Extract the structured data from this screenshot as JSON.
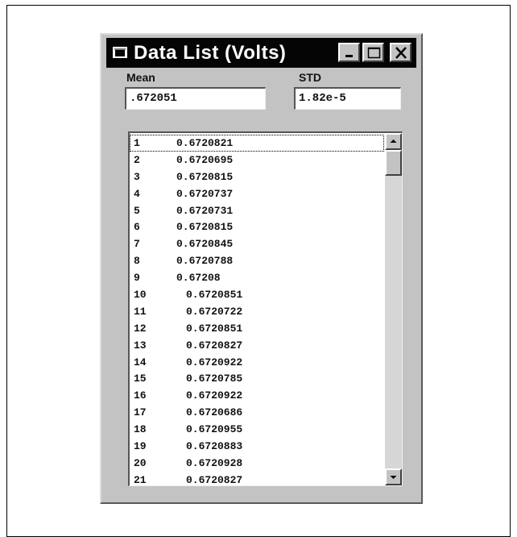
{
  "window": {
    "title": "Data List (Volts)"
  },
  "fields": {
    "mean_label": "Mean",
    "mean_value": ".672051",
    "std_label": "STD",
    "std_value": "1.82e-5"
  },
  "list": {
    "rows": [
      {
        "num": "1",
        "value": "0.6720821"
      },
      {
        "num": "2",
        "value": "0.6720695"
      },
      {
        "num": "3",
        "value": "0.6720815"
      },
      {
        "num": "4",
        "value": "0.6720737"
      },
      {
        "num": "5",
        "value": "0.6720731"
      },
      {
        "num": "6",
        "value": "0.6720815"
      },
      {
        "num": "7",
        "value": "0.6720845"
      },
      {
        "num": "8",
        "value": "0.6720788"
      },
      {
        "num": "9",
        "value": "0.67208"
      },
      {
        "num": "10",
        "value": "0.6720851"
      },
      {
        "num": "11",
        "value": "0.6720722"
      },
      {
        "num": "12",
        "value": "0.6720851"
      },
      {
        "num": "13",
        "value": "0.6720827"
      },
      {
        "num": "14",
        "value": "0.6720922"
      },
      {
        "num": "15",
        "value": "0.6720785"
      },
      {
        "num": "16",
        "value": "0.6720922"
      },
      {
        "num": "17",
        "value": "0.6720686"
      },
      {
        "num": "18",
        "value": "0.6720955"
      },
      {
        "num": "19",
        "value": "0.6720883"
      },
      {
        "num": "20",
        "value": "0.6720928"
      },
      {
        "num": "21",
        "value": "0.6720827"
      }
    ],
    "scroll_position": 0.0
  }
}
